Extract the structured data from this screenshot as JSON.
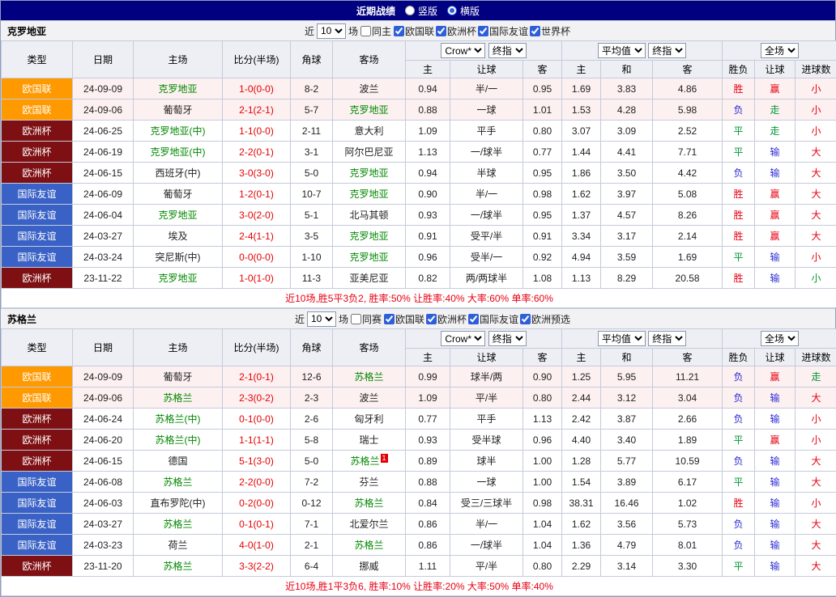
{
  "topbar": {
    "title": "近期战绩",
    "radios": [
      {
        "label": "竖版",
        "selected": false
      },
      {
        "label": "横版",
        "selected": true
      }
    ]
  },
  "colors": {
    "navy": "#010080",
    "type_colors": {
      "欧国联": "#FF9900",
      "欧洲杯": "#7E0F12",
      "国际友谊": "#3A62C6"
    },
    "result_colors": {
      "red": "#E60012",
      "green": "#009933",
      "blue": "#2B2BD5"
    },
    "team_green": "#008800",
    "score_red": "#E60000",
    "highlight_row": "#FDF0F0"
  },
  "table": {
    "headers": {
      "type": "类型",
      "date": "日期",
      "home": "主场",
      "score": "比分(半场)",
      "corners": "角球",
      "away": "客场"
    },
    "subheaders": [
      "主",
      "让球",
      "客",
      "主",
      "和",
      "客",
      "胜负",
      "让球",
      "进球数"
    ],
    "selects": {
      "company": "Crow*",
      "company_final": "终指",
      "average": "平均值",
      "average_final": "终指",
      "fulltime": "全场"
    }
  },
  "sections": [
    {
      "team": "克罗地亚",
      "filter": {
        "prefix": "近",
        "count": "10",
        "suffix": "场",
        "same_label": "同主",
        "same_checked": false,
        "leagues": [
          {
            "label": "欧国联",
            "checked": true
          },
          {
            "label": "欧洲杯",
            "checked": true
          },
          {
            "label": "国际友谊",
            "checked": true
          },
          {
            "label": "世界杯",
            "checked": true
          }
        ]
      },
      "rows": [
        {
          "type": "欧国联",
          "date": "24-09-09",
          "home": "克罗地亚",
          "home_team": true,
          "score": "1-0(0-0)",
          "corners": "8-2",
          "away": "波兰",
          "away_team": false,
          "asian": [
            "0.94",
            "半/一",
            "0.95"
          ],
          "europe": [
            "1.69",
            "3.83",
            "4.86"
          ],
          "results": [
            {
              "t": "胜",
              "c": "red"
            },
            {
              "t": "赢",
              "c": "red"
            },
            {
              "t": "小",
              "c": "red"
            }
          ],
          "highlight": true
        },
        {
          "type": "欧国联",
          "date": "24-09-06",
          "home": "葡萄牙",
          "home_team": false,
          "score": "2-1(2-1)",
          "corners": "5-7",
          "away": "克罗地亚",
          "away_team": true,
          "asian": [
            "0.88",
            "一球",
            "1.01"
          ],
          "europe": [
            "1.53",
            "4.28",
            "5.98"
          ],
          "results": [
            {
              "t": "负",
              "c": "blue"
            },
            {
              "t": "走",
              "c": "green"
            },
            {
              "t": "小",
              "c": "red"
            }
          ],
          "highlight": true
        },
        {
          "type": "欧洲杯",
          "date": "24-06-25",
          "home": "克罗地亚(中)",
          "home_team": true,
          "score": "1-1(0-0)",
          "corners": "2-11",
          "away": "意大利",
          "away_team": false,
          "asian": [
            "1.09",
            "平手",
            "0.80"
          ],
          "europe": [
            "3.07",
            "3.09",
            "2.52"
          ],
          "results": [
            {
              "t": "平",
              "c": "green"
            },
            {
              "t": "走",
              "c": "green"
            },
            {
              "t": "小",
              "c": "red"
            }
          ],
          "highlight": false
        },
        {
          "type": "欧洲杯",
          "date": "24-06-19",
          "home": "克罗地亚(中)",
          "home_team": true,
          "score": "2-2(0-1)",
          "corners": "3-1",
          "away": "阿尔巴尼亚",
          "away_team": false,
          "asian": [
            "1.13",
            "一/球半",
            "0.77"
          ],
          "europe": [
            "1.44",
            "4.41",
            "7.71"
          ],
          "results": [
            {
              "t": "平",
              "c": "green"
            },
            {
              "t": "输",
              "c": "blue"
            },
            {
              "t": "大",
              "c": "red"
            }
          ],
          "highlight": false
        },
        {
          "type": "欧洲杯",
          "date": "24-06-15",
          "home": "西班牙(中)",
          "home_team": false,
          "score": "3-0(3-0)",
          "corners": "5-0",
          "away": "克罗地亚",
          "away_team": true,
          "asian": [
            "0.94",
            "半球",
            "0.95"
          ],
          "europe": [
            "1.86",
            "3.50",
            "4.42"
          ],
          "results": [
            {
              "t": "负",
              "c": "blue"
            },
            {
              "t": "输",
              "c": "blue"
            },
            {
              "t": "大",
              "c": "red"
            }
          ],
          "highlight": false
        },
        {
          "type": "国际友谊",
          "date": "24-06-09",
          "home": "葡萄牙",
          "home_team": false,
          "score": "1-2(0-1)",
          "corners": "10-7",
          "away": "克罗地亚",
          "away_team": true,
          "asian": [
            "0.90",
            "半/一",
            "0.98"
          ],
          "europe": [
            "1.62",
            "3.97",
            "5.08"
          ],
          "results": [
            {
              "t": "胜",
              "c": "red"
            },
            {
              "t": "赢",
              "c": "red"
            },
            {
              "t": "大",
              "c": "red"
            }
          ],
          "highlight": false
        },
        {
          "type": "国际友谊",
          "date": "24-06-04",
          "home": "克罗地亚",
          "home_team": true,
          "score": "3-0(2-0)",
          "corners": "5-1",
          "away": "北马其顿",
          "away_team": false,
          "asian": [
            "0.93",
            "一/球半",
            "0.95"
          ],
          "europe": [
            "1.37",
            "4.57",
            "8.26"
          ],
          "results": [
            {
              "t": "胜",
              "c": "red"
            },
            {
              "t": "赢",
              "c": "red"
            },
            {
              "t": "大",
              "c": "red"
            }
          ],
          "highlight": false
        },
        {
          "type": "国际友谊",
          "date": "24-03-27",
          "home": "埃及",
          "home_team": false,
          "score": "2-4(1-1)",
          "corners": "3-5",
          "away": "克罗地亚",
          "away_team": true,
          "asian": [
            "0.91",
            "受平/半",
            "0.91"
          ],
          "europe": [
            "3.34",
            "3.17",
            "2.14"
          ],
          "results": [
            {
              "t": "胜",
              "c": "red"
            },
            {
              "t": "赢",
              "c": "red"
            },
            {
              "t": "大",
              "c": "red"
            }
          ],
          "highlight": false
        },
        {
          "type": "国际友谊",
          "date": "24-03-24",
          "home": "突尼斯(中)",
          "home_team": false,
          "score": "0-0(0-0)",
          "corners": "1-10",
          "away": "克罗地亚",
          "away_team": true,
          "asian": [
            "0.96",
            "受半/一",
            "0.92"
          ],
          "europe": [
            "4.94",
            "3.59",
            "1.69"
          ],
          "results": [
            {
              "t": "平",
              "c": "green"
            },
            {
              "t": "输",
              "c": "blue"
            },
            {
              "t": "小",
              "c": "red"
            }
          ],
          "highlight": false
        },
        {
          "type": "欧洲杯",
          "date": "23-11-22",
          "home": "克罗地亚",
          "home_team": true,
          "score": "1-0(1-0)",
          "corners": "11-3",
          "away": "亚美尼亚",
          "away_team": false,
          "asian": [
            "0.82",
            "两/两球半",
            "1.08"
          ],
          "europe": [
            "1.13",
            "8.29",
            "20.58"
          ],
          "results": [
            {
              "t": "胜",
              "c": "red"
            },
            {
              "t": "输",
              "c": "blue"
            },
            {
              "t": "小",
              "c": "green"
            }
          ],
          "highlight": false
        }
      ],
      "summary": "近10场,胜5平3负2, 胜率:50% 让胜率:40% 大率:60% 单率:60%"
    },
    {
      "team": "苏格兰",
      "filter": {
        "prefix": "近",
        "count": "10",
        "suffix": "场",
        "same_label": "同赛",
        "same_checked": false,
        "leagues": [
          {
            "label": "欧国联",
            "checked": true
          },
          {
            "label": "欧洲杯",
            "checked": true
          },
          {
            "label": "国际友谊",
            "checked": true
          },
          {
            "label": "欧洲预选",
            "checked": true
          }
        ]
      },
      "rows": [
        {
          "type": "欧国联",
          "date": "24-09-09",
          "home": "葡萄牙",
          "home_team": false,
          "score": "2-1(0-1)",
          "corners": "12-6",
          "away": "苏格兰",
          "away_team": true,
          "asian": [
            "0.99",
            "球半/两",
            "0.90"
          ],
          "europe": [
            "1.25",
            "5.95",
            "11.21"
          ],
          "results": [
            {
              "t": "负",
              "c": "blue"
            },
            {
              "t": "赢",
              "c": "red"
            },
            {
              "t": "走",
              "c": "green"
            }
          ],
          "highlight": true
        },
        {
          "type": "欧国联",
          "date": "24-09-06",
          "home": "苏格兰",
          "home_team": true,
          "score": "2-3(0-2)",
          "corners": "2-3",
          "away": "波兰",
          "away_team": false,
          "asian": [
            "1.09",
            "平/半",
            "0.80"
          ],
          "europe": [
            "2.44",
            "3.12",
            "3.04"
          ],
          "results": [
            {
              "t": "负",
              "c": "blue"
            },
            {
              "t": "输",
              "c": "blue"
            },
            {
              "t": "大",
              "c": "red"
            }
          ],
          "highlight": true
        },
        {
          "type": "欧洲杯",
          "date": "24-06-24",
          "home": "苏格兰(中)",
          "home_team": true,
          "score": "0-1(0-0)",
          "corners": "2-6",
          "away": "匈牙利",
          "away_team": false,
          "asian": [
            "0.77",
            "平手",
            "1.13"
          ],
          "europe": [
            "2.42",
            "3.87",
            "2.66"
          ],
          "results": [
            {
              "t": "负",
              "c": "blue"
            },
            {
              "t": "输",
              "c": "blue"
            },
            {
              "t": "小",
              "c": "red"
            }
          ],
          "highlight": false
        },
        {
          "type": "欧洲杯",
          "date": "24-06-20",
          "home": "苏格兰(中)",
          "home_team": true,
          "score": "1-1(1-1)",
          "corners": "5-8",
          "away": "瑞士",
          "away_team": false,
          "asian": [
            "0.93",
            "受半球",
            "0.96"
          ],
          "europe": [
            "4.40",
            "3.40",
            "1.89"
          ],
          "results": [
            {
              "t": "平",
              "c": "green"
            },
            {
              "t": "赢",
              "c": "red"
            },
            {
              "t": "小",
              "c": "red"
            }
          ],
          "highlight": false
        },
        {
          "type": "欧洲杯",
          "date": "24-06-15",
          "home": "德国",
          "home_team": false,
          "score": "5-1(3-0)",
          "corners": "5-0",
          "away": "苏格兰",
          "away_team": true,
          "away_badge": "1",
          "asian": [
            "0.89",
            "球半",
            "1.00"
          ],
          "europe": [
            "1.28",
            "5.77",
            "10.59"
          ],
          "results": [
            {
              "t": "负",
              "c": "blue"
            },
            {
              "t": "输",
              "c": "blue"
            },
            {
              "t": "大",
              "c": "red"
            }
          ],
          "highlight": false
        },
        {
          "type": "国际友谊",
          "date": "24-06-08",
          "home": "苏格兰",
          "home_team": true,
          "score": "2-2(0-0)",
          "corners": "7-2",
          "away": "芬兰",
          "away_team": false,
          "asian": [
            "0.88",
            "一球",
            "1.00"
          ],
          "europe": [
            "1.54",
            "3.89",
            "6.17"
          ],
          "results": [
            {
              "t": "平",
              "c": "green"
            },
            {
              "t": "输",
              "c": "blue"
            },
            {
              "t": "大",
              "c": "red"
            }
          ],
          "highlight": false
        },
        {
          "type": "国际友谊",
          "date": "24-06-03",
          "home": "直布罗陀(中)",
          "home_team": false,
          "score": "0-2(0-0)",
          "corners": "0-12",
          "away": "苏格兰",
          "away_team": true,
          "asian": [
            "0.84",
            "受三/三球半",
            "0.98"
          ],
          "europe": [
            "38.31",
            "16.46",
            "1.02"
          ],
          "results": [
            {
              "t": "胜",
              "c": "red"
            },
            {
              "t": "输",
              "c": "blue"
            },
            {
              "t": "小",
              "c": "red"
            }
          ],
          "highlight": false
        },
        {
          "type": "国际友谊",
          "date": "24-03-27",
          "home": "苏格兰",
          "home_team": true,
          "score": "0-1(0-1)",
          "corners": "7-1",
          "away": "北爱尔兰",
          "away_team": false,
          "asian": [
            "0.86",
            "半/一",
            "1.04"
          ],
          "europe": [
            "1.62",
            "3.56",
            "5.73"
          ],
          "results": [
            {
              "t": "负",
              "c": "blue"
            },
            {
              "t": "输",
              "c": "blue"
            },
            {
              "t": "大",
              "c": "red"
            }
          ],
          "highlight": false
        },
        {
          "type": "国际友谊",
          "date": "24-03-23",
          "home": "荷兰",
          "home_team": false,
          "score": "4-0(1-0)",
          "corners": "2-1",
          "away": "苏格兰",
          "away_team": true,
          "asian": [
            "0.86",
            "一/球半",
            "1.04"
          ],
          "europe": [
            "1.36",
            "4.79",
            "8.01"
          ],
          "results": [
            {
              "t": "负",
              "c": "blue"
            },
            {
              "t": "输",
              "c": "blue"
            },
            {
              "t": "大",
              "c": "red"
            }
          ],
          "highlight": false
        },
        {
          "type": "欧洲杯",
          "date": "23-11-20",
          "home": "苏格兰",
          "home_team": true,
          "score": "3-3(2-2)",
          "corners": "6-4",
          "away": "挪威",
          "away_team": false,
          "asian": [
            "1.11",
            "平/半",
            "0.80"
          ],
          "europe": [
            "2.29",
            "3.14",
            "3.30"
          ],
          "results": [
            {
              "t": "平",
              "c": "green"
            },
            {
              "t": "输",
              "c": "blue"
            },
            {
              "t": "大",
              "c": "red"
            }
          ],
          "highlight": false
        }
      ],
      "summary": "近10场,胜1平3负6, 胜率:10% 让胜率:20% 大率:50% 单率:40%"
    }
  ]
}
